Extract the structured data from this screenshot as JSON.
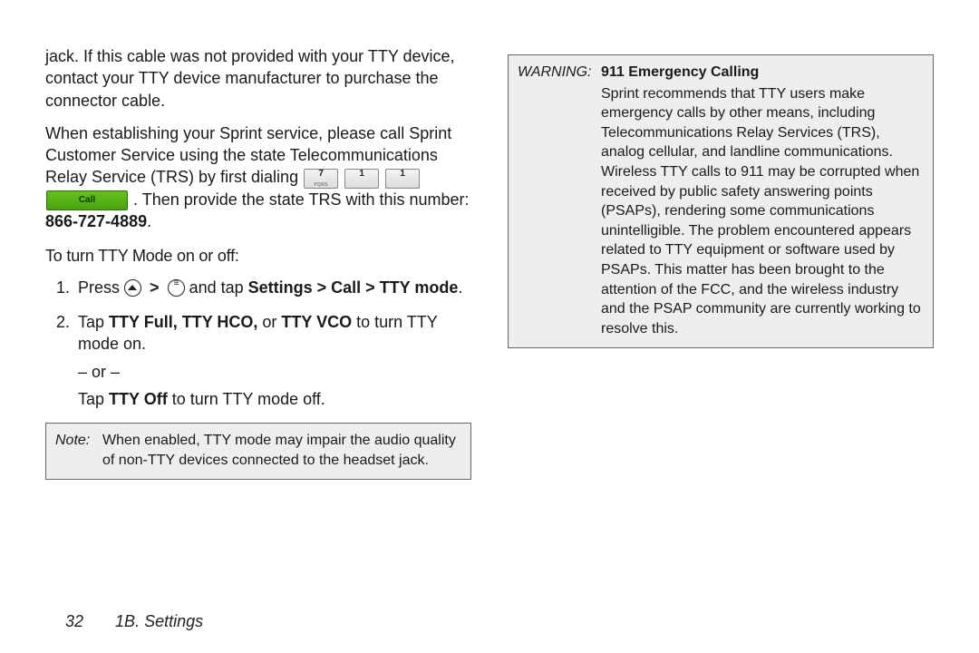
{
  "left": {
    "p1": "jack. If this cable was not provided with your TTY device, contact your TTY device manufacturer to purchase the connector cable.",
    "p2a": "When establishing your Sprint service, please call Sprint Customer Service using the state Telecommunications Relay Service (TRS) by first dialing ",
    "key7_num": "7",
    "key7_sub": "PQRS",
    "key1a_num": "1",
    "key1a_sub": "",
    "key1b_num": "1",
    "key1b_sub": "",
    "call_label": "Call",
    "p2b": ". Then provide the state TRS with this number: ",
    "trs_number": "866-727-4889",
    "p2c": ".",
    "subhead": "To turn TTY Mode on or off:",
    "step1a": "Press ",
    "step1b": " and tap ",
    "step1c": "Settings > Call > TTY mode",
    "step1d": ".",
    "step2a": "Tap ",
    "step2b_bold": "TTY Full, TTY HCO,",
    "step2c": " or ",
    "step2d_bold": "TTY VCO",
    "step2e": " to turn TTY mode on.",
    "or_text": "– or –",
    "step2f": "Tap ",
    "step2g_bold": "TTY Off",
    "step2h": " to turn TTY mode off.",
    "note_label": "Note:",
    "note_body": "When enabled, TTY mode may impair the audio quality of non-TTY devices connected to the headset jack."
  },
  "right": {
    "warn_label": "WARNING:",
    "warn_title": "911 Emergency Calling",
    "warn_body": "Sprint recommends that TTY users make emergency calls by other means, including Telecommunications Relay Services (TRS), analog cellular, and landline communications. Wireless TTY calls to 911 may be corrupted when received by public safety answering points (PSAPs), rendering some communications unintelligible. The problem encountered appears related to TTY equipment or software used by PSAPs. This matter has been brought to the attention of the FCC, and the wireless industry and the PSAP community are currently working to resolve this."
  },
  "footer": {
    "page": "32",
    "section": "1B. Settings"
  }
}
